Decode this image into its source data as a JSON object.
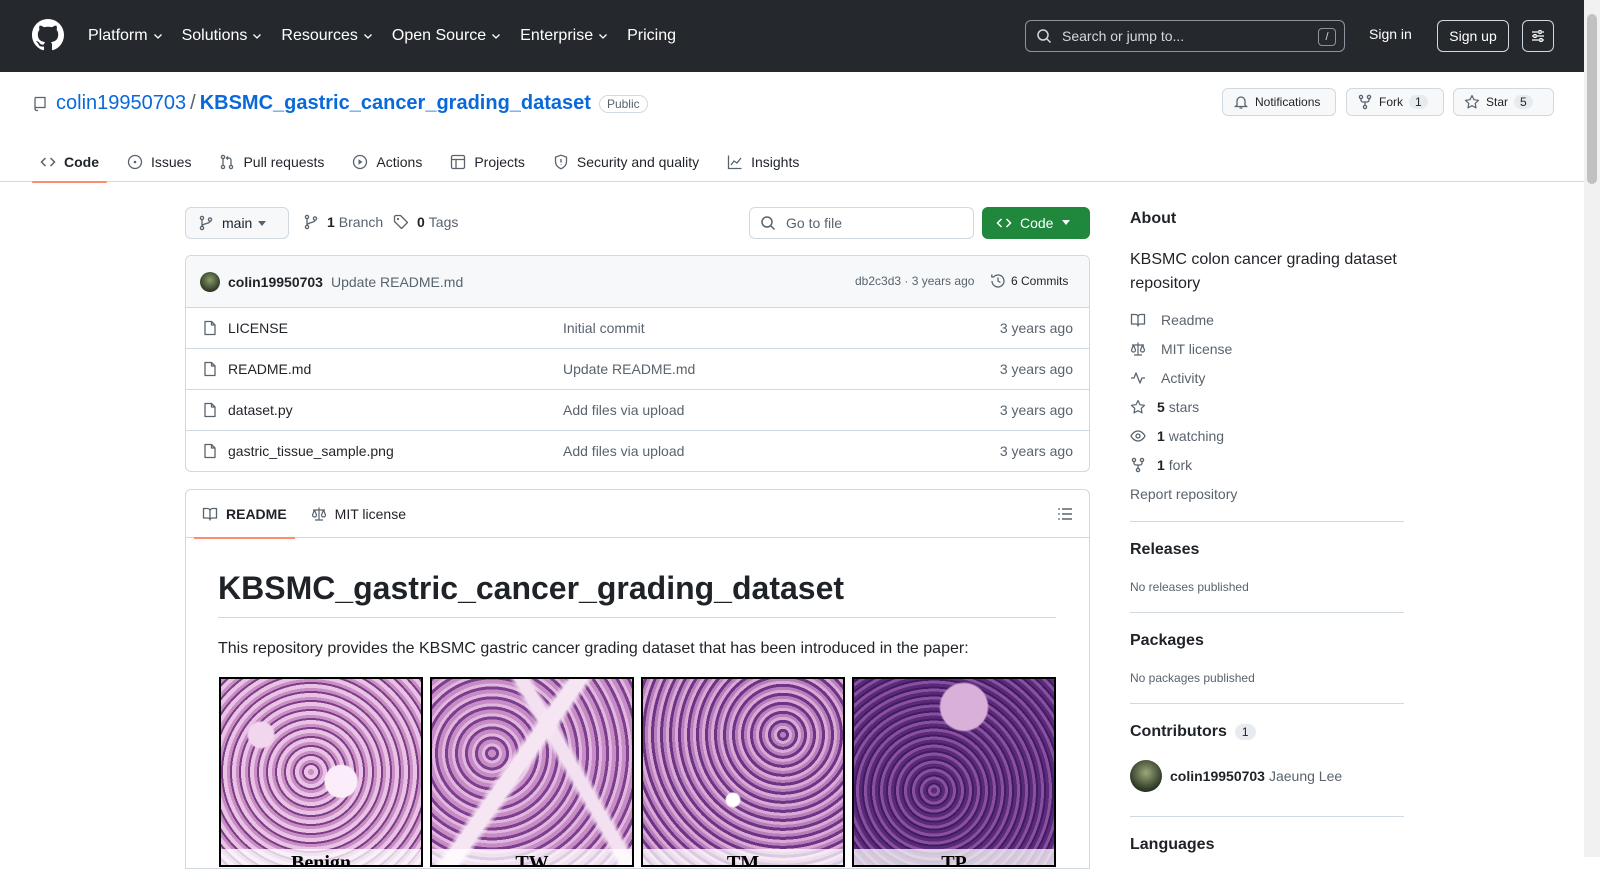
{
  "nav": {
    "items": [
      {
        "label": "Platform",
        "dropdown": true
      },
      {
        "label": "Solutions",
        "dropdown": true
      },
      {
        "label": "Resources",
        "dropdown": true
      },
      {
        "label": "Open Source",
        "dropdown": true
      },
      {
        "label": "Enterprise",
        "dropdown": true
      },
      {
        "label": "Pricing",
        "dropdown": false
      }
    ],
    "search_placeholder": "Search or jump to...",
    "search_shortcut": "/",
    "sign_in": "Sign in",
    "sign_up": "Sign up"
  },
  "repo": {
    "owner": "colin19950703",
    "separator": "/",
    "name": "KBSMC_gastric_cancer_grading_dataset",
    "visibility": "Public",
    "notifications_label": "Notifications",
    "fork_label": "Fork",
    "fork_count": "1",
    "star_label": "Star",
    "star_count": "5"
  },
  "tabs": [
    {
      "label": "Code",
      "icon": "code-icon",
      "active": true
    },
    {
      "label": "Issues",
      "icon": "issue-icon",
      "active": false
    },
    {
      "label": "Pull requests",
      "icon": "pull-request-icon",
      "active": false
    },
    {
      "label": "Actions",
      "icon": "play-icon",
      "active": false
    },
    {
      "label": "Projects",
      "icon": "table-icon",
      "active": false
    },
    {
      "label": "Security and quality",
      "icon": "shield-icon",
      "active": false
    },
    {
      "label": "Insights",
      "icon": "graph-icon",
      "active": false
    }
  ],
  "branchbar": {
    "branch": "main",
    "branch_count": "1",
    "branch_label": "Branch",
    "tag_count": "0",
    "tag_label": "Tags",
    "goto_placeholder": "Go to file",
    "code_button": "Code"
  },
  "latest_commit": {
    "author": "colin19950703",
    "message": "Update README.md",
    "sha_time": "db2c3d3 · 3 years ago",
    "commits": "6 Commits"
  },
  "files": [
    {
      "name": "LICENSE",
      "message": "Initial commit",
      "date": "3 years ago"
    },
    {
      "name": "README.md",
      "message": "Update README.md",
      "date": "3 years ago"
    },
    {
      "name": "dataset.py",
      "message": "Add files via upload",
      "date": "3 years ago"
    },
    {
      "name": "gastric_tissue_sample.png",
      "message": "Add files via upload",
      "date": "3 years ago"
    }
  ],
  "readme": {
    "tab_readme": "README",
    "tab_license": "MIT license",
    "heading": "KBSMC_gastric_cancer_grading_dataset",
    "intro": "This repository provides the KBSMC gastric cancer grading dataset that has been introduced in the paper:",
    "tile_labels": [
      "Benign",
      "TW",
      "TM",
      "TP"
    ]
  },
  "sidebar": {
    "about_title": "About",
    "description": "KBSMC colon cancer grading dataset repository",
    "links": [
      {
        "icon": "book-icon",
        "bold": "",
        "text": "Readme"
      },
      {
        "icon": "law-icon",
        "bold": "",
        "text": "MIT license"
      },
      {
        "icon": "pulse-icon",
        "bold": "",
        "text": "Activity"
      },
      {
        "icon": "star-icon",
        "bold": "5",
        "text": "stars"
      },
      {
        "icon": "eye-icon",
        "bold": "1",
        "text": "watching"
      },
      {
        "icon": "fork-icon",
        "bold": "1",
        "text": "fork"
      }
    ],
    "report": "Report repository",
    "releases_title": "Releases",
    "releases_note": "No releases published",
    "packages_title": "Packages",
    "packages_note": "No packages published",
    "contributors_title": "Contributors",
    "contributors_count": "1",
    "contributor_login": "colin19950703",
    "contributor_name": "Jaeung Lee",
    "languages_title": "Languages"
  }
}
